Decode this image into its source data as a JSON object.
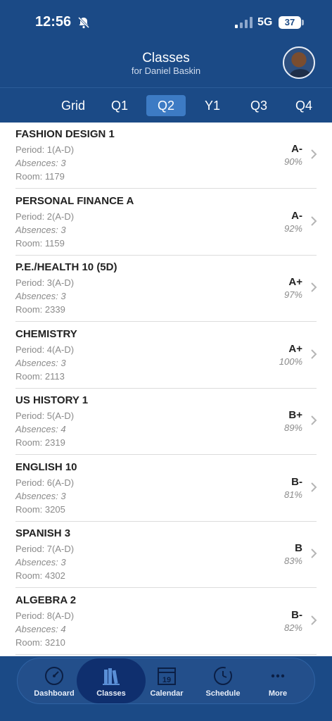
{
  "status_bar": {
    "time": "12:56",
    "network": "5G",
    "battery": "37"
  },
  "header": {
    "title": "Classes",
    "subtitle": "for Daniel Baskin"
  },
  "tabs": [
    {
      "label": "Grid"
    },
    {
      "label": "Q1"
    },
    {
      "label": "Q2",
      "active": true
    },
    {
      "label": "Y1"
    },
    {
      "label": "Q3"
    },
    {
      "label": "Q4"
    }
  ],
  "classes": [
    {
      "name": "FASHION DESIGN 1",
      "period": "Period: 1(A-D)",
      "absences": "Absences: 3",
      "room": "Room: 1179",
      "grade": "A-",
      "percent": "90%"
    },
    {
      "name": "PERSONAL FINANCE A",
      "period": "Period: 2(A-D)",
      "absences": "Absences: 3",
      "room": "Room: 1159",
      "grade": "A-",
      "percent": "92%"
    },
    {
      "name": "P.E./HEALTH 10 (5D)",
      "period": "Period: 3(A-D)",
      "absences": "Absences: 3",
      "room": "Room: 2339",
      "grade": "A+",
      "percent": "97%"
    },
    {
      "name": "CHEMISTRY",
      "period": "Period: 4(A-D)",
      "absences": "Absences: 3",
      "room": "Room: 2113",
      "grade": "A+",
      "percent": "100%"
    },
    {
      "name": "US HISTORY 1",
      "period": "Period: 5(A-D)",
      "absences": "Absences: 4",
      "room": "Room: 2319",
      "grade": "B+",
      "percent": "89%"
    },
    {
      "name": "ENGLISH 10",
      "period": "Period: 6(A-D)",
      "absences": "Absences: 3",
      "room": "Room: 3205",
      "grade": "B-",
      "percent": "81%"
    },
    {
      "name": "SPANISH 3",
      "period": "Period: 7(A-D)",
      "absences": "Absences: 3",
      "room": "Room: 4302",
      "grade": "B",
      "percent": "83%"
    },
    {
      "name": "ALGEBRA 2",
      "period": "Period: 8(A-D)",
      "absences": "Absences: 4",
      "room": "Room: 3210",
      "grade": "B-",
      "percent": "82%"
    }
  ],
  "bottom_nav": [
    {
      "label": "Dashboard",
      "icon": "speedometer-icon"
    },
    {
      "label": "Classes",
      "icon": "books-icon",
      "active": true
    },
    {
      "label": "Calendar",
      "icon": "calendar-icon",
      "day": "19"
    },
    {
      "label": "Schedule",
      "icon": "clock-icon"
    },
    {
      "label": "More",
      "icon": "more-dots-icon"
    }
  ],
  "colors": {
    "header_bg": "#1b4a86",
    "tab_active": "#3d7bc4",
    "nav_active": "#0f2f6e"
  }
}
